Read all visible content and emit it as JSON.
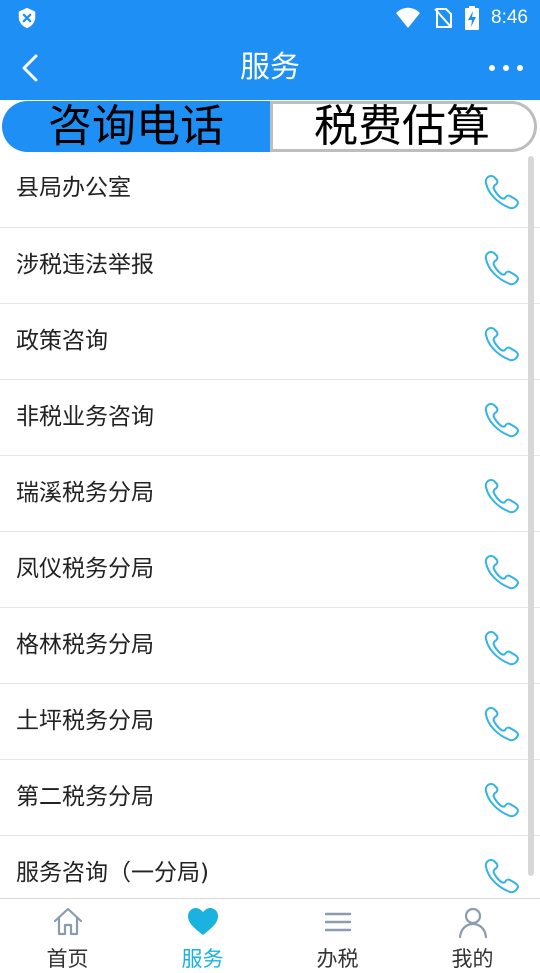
{
  "status_bar": {
    "time": "8:46"
  },
  "header": {
    "title": "服务"
  },
  "tabs": [
    {
      "label": "咨询电话",
      "active": true
    },
    {
      "label": "税费估算",
      "active": false
    }
  ],
  "contacts": [
    {
      "name": "县局办公室"
    },
    {
      "name": "涉税违法举报"
    },
    {
      "name": "政策咨询"
    },
    {
      "name": "非税业务咨询"
    },
    {
      "name": "瑞溪税务分局"
    },
    {
      "name": "凤仪税务分局"
    },
    {
      "name": "格林税务分局"
    },
    {
      "name": "土坪税务分局"
    },
    {
      "name": "第二税务分局"
    },
    {
      "name": "服务咨询（一分局)"
    }
  ],
  "bottom_nav": [
    {
      "label": "首页",
      "icon": "home-icon",
      "active": false
    },
    {
      "label": "服务",
      "icon": "heart-icon",
      "active": true
    },
    {
      "label": "办税",
      "icon": "menu-icon",
      "active": false
    },
    {
      "label": "我的",
      "icon": "user-icon",
      "active": false
    }
  ],
  "colors": {
    "primary": "#1e8ff5",
    "accent": "#1ab3e0",
    "phone_icon": "#33b3e6"
  }
}
